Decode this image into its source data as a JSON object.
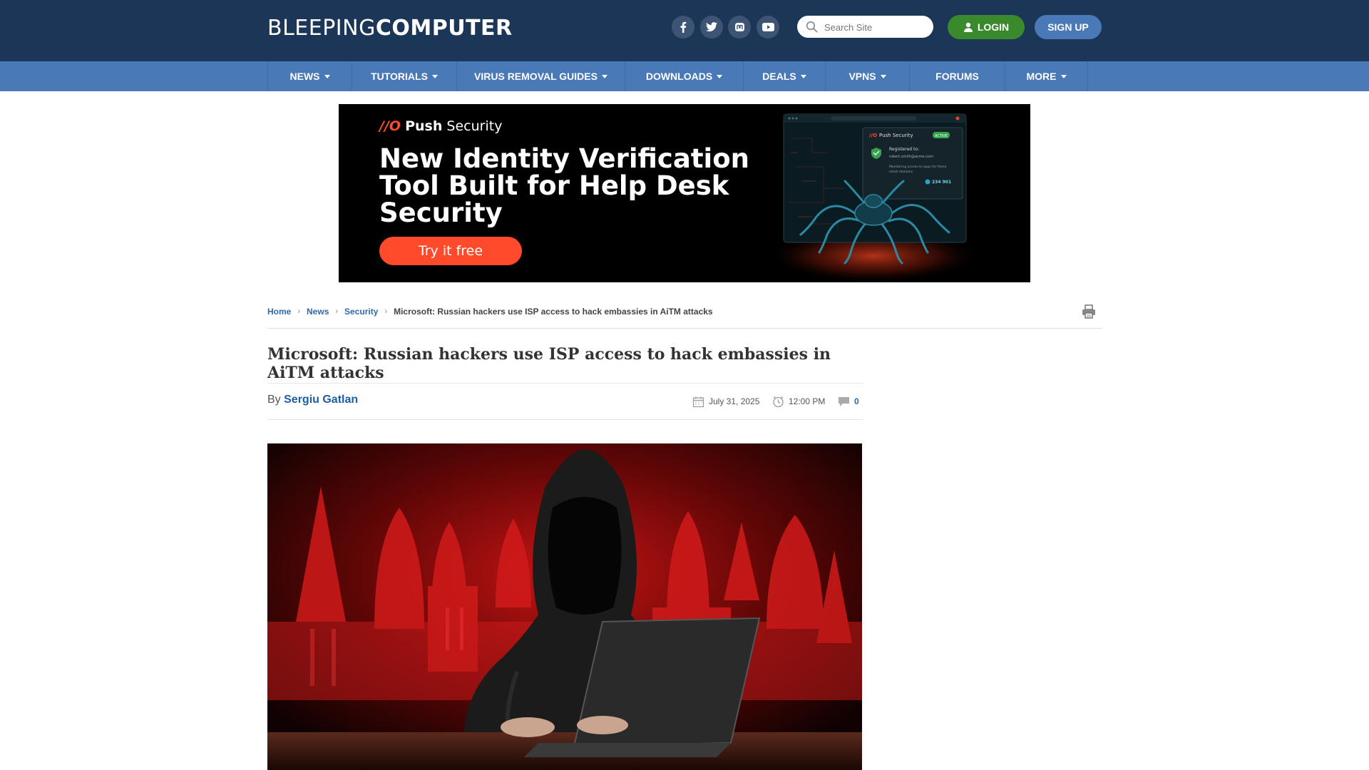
{
  "header": {
    "logo_part1": "BLEEPING",
    "logo_part2": "COMPUTER",
    "search_placeholder": "Search Site",
    "login_label": "LOGIN",
    "signup_label": "SIGN UP",
    "social_icons": [
      "facebook-icon",
      "twitter-icon",
      "mastodon-icon",
      "youtube-icon"
    ]
  },
  "nav": {
    "items": [
      {
        "label": "NEWS",
        "dropdown": true
      },
      {
        "label": "TUTORIALS",
        "dropdown": true
      },
      {
        "label": "VIRUS REMOVAL GUIDES",
        "dropdown": true
      },
      {
        "label": "DOWNLOADS",
        "dropdown": true
      },
      {
        "label": "DEALS",
        "dropdown": true
      },
      {
        "label": "VPNS",
        "dropdown": true
      },
      {
        "label": "FORUMS",
        "dropdown": false
      },
      {
        "label": "MORE",
        "dropdown": true
      }
    ]
  },
  "ad": {
    "brand_mark": "//O",
    "brand_bold": "Push",
    "brand_light": " Security",
    "headline": "New Identity Verification Tool Built for Help Desk Security",
    "cta": "Try it free",
    "mock_brand": "Push Security",
    "mock_badge": "ACTIVE",
    "mock_registered": "Registered to:",
    "mock_email": "robert.smith@acme.com",
    "mock_monitor1": "Monitoring access to apps for these",
    "mock_monitor2": "email domains",
    "mock_count": "234 901"
  },
  "breadcrumb": {
    "home": "Home",
    "news": "News",
    "security": "Security",
    "current": "Microsoft: Russian hackers use ISP access to hack embassies in AiTM attacks"
  },
  "article": {
    "title": "Microsoft: Russian hackers use ISP access to hack embassies in AiTM attacks",
    "by": "By ",
    "author": "Sergiu Gatlan",
    "date": "July 31, 2025",
    "time": "12:00 PM",
    "comments": "0"
  },
  "colors": {
    "header_bg": "#1c3658",
    "nav_bg": "#4a79b8",
    "login_green": "#3a8a2d",
    "link_blue": "#2d6ab1",
    "ad_accent": "#ff4a2b"
  }
}
